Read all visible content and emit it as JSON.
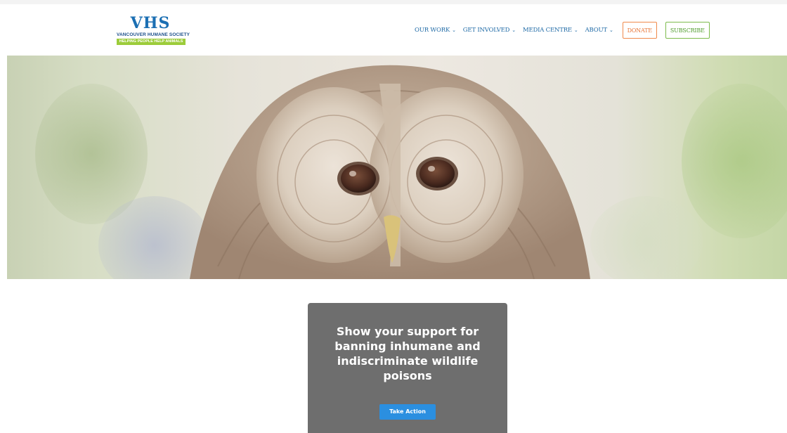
{
  "logo": {
    "mark": "VHS",
    "name": "VANCOUVER HUMANE SOCIETY",
    "tagline": "HELPING PEOPLE HELP ANIMALS",
    "colors": {
      "mark": "#1b6fb3",
      "tagline_bg": "#9ccc3a"
    }
  },
  "nav": {
    "items": [
      {
        "label": "OUR WORK",
        "icon": "chevron-down-icon"
      },
      {
        "label": "GET INVOLVED",
        "icon": "chevron-down-icon"
      },
      {
        "label": "MEDIA CENTRE",
        "icon": "chevron-down-icon"
      },
      {
        "label": "ABOUT",
        "icon": "chevron-down-icon"
      }
    ],
    "donate_label": "DONATE",
    "subscribe_label": "SUBSCRIBE",
    "colors": {
      "link": "#1f6aa6",
      "donate": "#e8773a",
      "subscribe": "#4f9c2c"
    }
  },
  "hero": {
    "image_subject": "barred-owl-photo"
  },
  "cta": {
    "title": "Show your support for banning inhumane and indiscriminate wildlife poisons",
    "button_label": "Take Action",
    "colors": {
      "card_bg": "#6e6e6e",
      "button_bg": "#2b8fe0"
    }
  }
}
